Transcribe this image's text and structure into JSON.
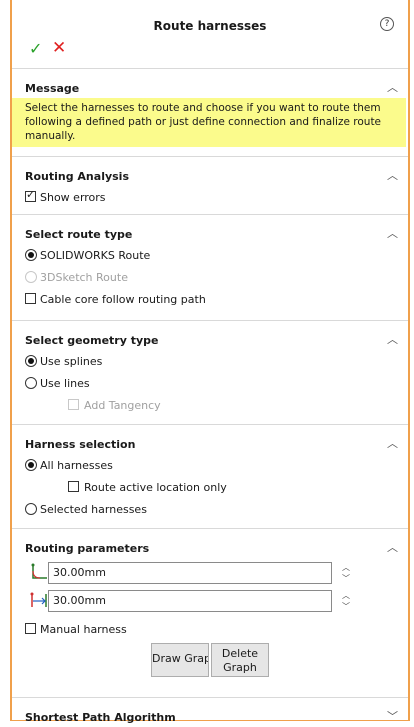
{
  "header": {
    "title": "Route harnesses",
    "help_icon": "question-circle-icon"
  },
  "actions": {
    "ok_icon": "checkmark-icon",
    "cancel_icon": "close-icon",
    "ok_color": "#2aa12a",
    "cancel_color": "#e02020"
  },
  "message": {
    "heading": "Message",
    "text": "Select the harnesses to route and choose if you want to route them following a defined path or just define connection and finalize route manually.",
    "bg_color": "#fbfb8c"
  },
  "routing_analysis": {
    "heading": "Routing Analysis",
    "show_errors": {
      "label": "Show errors",
      "checked": true
    }
  },
  "route_type": {
    "heading": "Select route type",
    "options": [
      {
        "label": "SOLIDWORKS Route",
        "selected": true,
        "enabled": true
      },
      {
        "label": "3DSketch Route",
        "selected": false,
        "enabled": false
      }
    ],
    "cable_core": {
      "label": "Cable core follow routing path",
      "checked": false
    }
  },
  "geometry_type": {
    "heading": "Select geometry type",
    "options": [
      {
        "label": "Use splines",
        "selected": true
      },
      {
        "label": "Use lines",
        "selected": false
      }
    ],
    "add_tangency": {
      "label": "Add Tangency",
      "checked": false,
      "enabled": false
    }
  },
  "harness_selection": {
    "heading": "Harness selection",
    "all": {
      "label": "All harnesses",
      "selected": true
    },
    "route_active": {
      "label": "Route active location only",
      "checked": false
    },
    "selected": {
      "label": "Selected harnesses",
      "selected": false
    }
  },
  "routing_parameters": {
    "heading": "Routing parameters",
    "param1": {
      "value": "30.00mm",
      "icon": "bend-radius-icon"
    },
    "param2": {
      "value": "30.00mm",
      "icon": "offset-distance-icon"
    },
    "manual_harness": {
      "label": "Manual harness",
      "checked": false
    },
    "draw_graph_label": "Draw Graph",
    "delete_graph_label": "Delete Graph"
  },
  "shortest_path": {
    "heading": "Shortest Path Algorithm",
    "collapsed": true
  },
  "colors": {
    "frame_border": "#f0a04b"
  }
}
